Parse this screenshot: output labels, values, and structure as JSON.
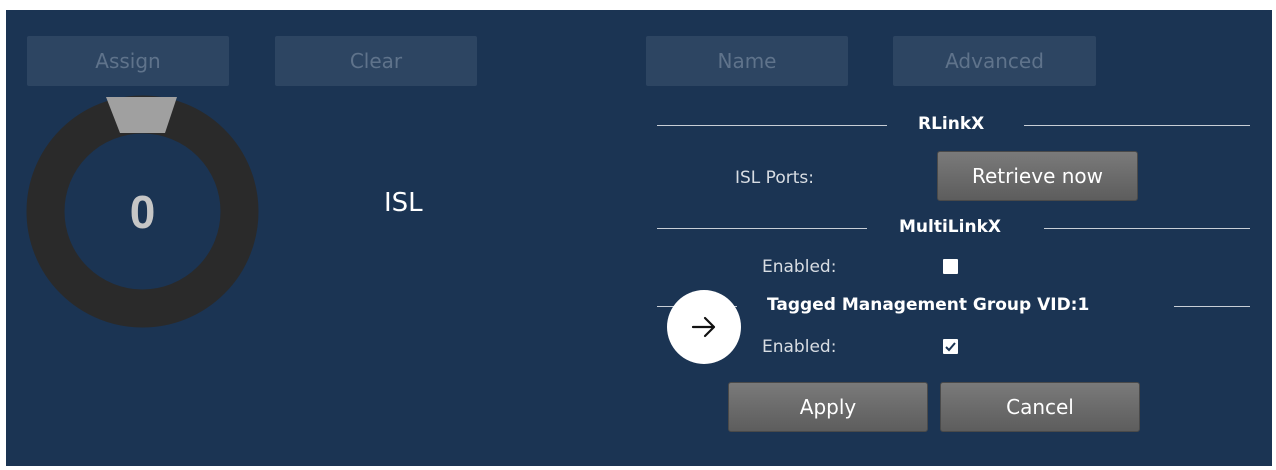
{
  "toolbar": {
    "assign_label": "Assign",
    "clear_label": "Clear",
    "name_label": "Name",
    "advanced_label": "Advanced"
  },
  "gauge": {
    "value": "0",
    "caption": "ISL"
  },
  "rlinkx": {
    "title": "RLinkX",
    "isl_ports_label": "ISL Ports:",
    "retrieve_label": "Retrieve now"
  },
  "multilinkx": {
    "title": "MultiLinkX",
    "enabled_label": "Enabled:",
    "enabled_checked": false
  },
  "tagged_mgmt": {
    "title": "Tagged Management Group VID:1",
    "enabled_label": "Enabled:",
    "enabled_checked": true
  },
  "actions": {
    "apply_label": "Apply",
    "cancel_label": "Cancel"
  },
  "colors": {
    "panel_bg": "#1b3453",
    "disabled_button_bg": "#2d4562",
    "donut_ring": "#2a2a2a",
    "donut_marker": "#a0a0a0"
  }
}
